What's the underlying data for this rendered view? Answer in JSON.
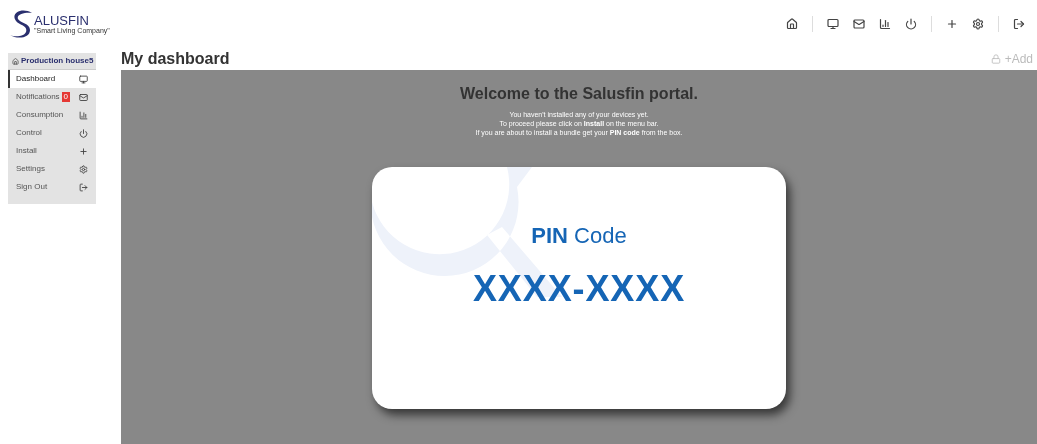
{
  "logo": {
    "brand": "ALUSFIN",
    "tagline": "\"Smart Living Company\""
  },
  "toolbar": [
    {
      "kind": "home"
    },
    {
      "kind": "sep"
    },
    {
      "kind": "monitor"
    },
    {
      "kind": "mail"
    },
    {
      "kind": "chart"
    },
    {
      "kind": "power"
    },
    {
      "kind": "sep"
    },
    {
      "kind": "plus"
    },
    {
      "kind": "gear"
    },
    {
      "kind": "sep"
    },
    {
      "kind": "signout"
    }
  ],
  "sidebar": {
    "header": "Production house5",
    "items": [
      {
        "label": "Dashboard",
        "kind": "monitor",
        "selected": true
      },
      {
        "label": "Notifications",
        "kind": "mail",
        "badge": "0",
        "selected": false
      },
      {
        "label": "Consumption",
        "kind": "chart",
        "selected": false
      },
      {
        "label": "Control",
        "kind": "power",
        "selected": false
      },
      {
        "label": "Install",
        "kind": "plus",
        "selected": false
      },
      {
        "label": "Settings",
        "kind": "gear",
        "selected": false
      },
      {
        "label": "Sign Out",
        "kind": "signout",
        "selected": false
      }
    ]
  },
  "page": {
    "title": "My dashboard",
    "add_button": "+Add",
    "add_locked": true
  },
  "welcome": {
    "title": "Welcome to the Salusfin portal.",
    "lines": [
      "You haven't installed any of your devices yet.",
      "To proceed please click on **Install** on the menu bar.",
      "If you are about to install a bundle get your **PIN code** from the box."
    ]
  },
  "pin_card": {
    "label_strong": "PIN",
    "label": "Code",
    "code": "XXXX-XXXX"
  }
}
